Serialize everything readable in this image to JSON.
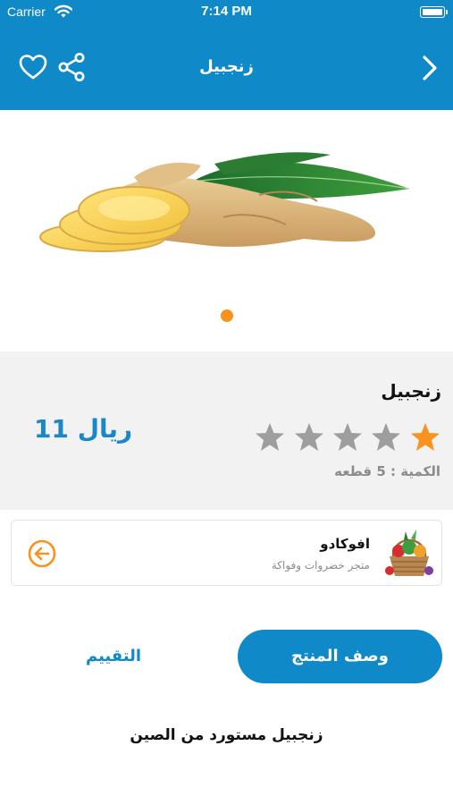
{
  "status_bar": {
    "carrier": "Carrier",
    "time": "7:14 PM"
  },
  "nav": {
    "title": "زنجبيل",
    "back_icon": "chevron-right-icon",
    "favorite_icon": "heart-outline-icon",
    "share_icon": "share-icon"
  },
  "gallery": {
    "image": "ginger-root-with-leaves",
    "page_count": 1,
    "active_page": 1
  },
  "product": {
    "name": "زنجبيل",
    "price": "ريال 11",
    "quantity": "الكمية : 5 قطعه",
    "rating": 1,
    "rating_max": 5
  },
  "store": {
    "name": "افوكادو",
    "subtitle": "متجر خضروات وفواكة",
    "thumb_icon": "vegetable-basket-image",
    "arrow_icon": "arrow-circle-left-icon"
  },
  "tabs": {
    "description_label": "وصف المنتج",
    "rating_label": "التقييم",
    "active": "description"
  },
  "description_text": "زنجبيل مستورد من الصين",
  "colors": {
    "primary": "#1089c9",
    "accent": "#f7931e",
    "star_inactive": "#9e9e9e",
    "panel_bg": "#f2f2f2",
    "muted_text": "#8c8c8c"
  }
}
